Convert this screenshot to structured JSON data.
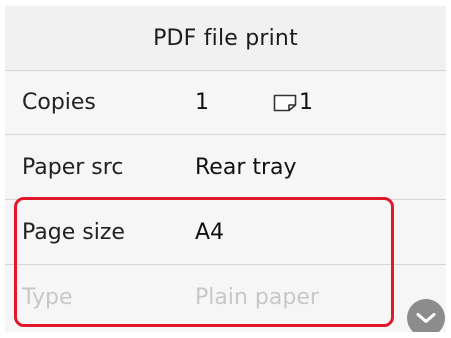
{
  "header": {
    "title": "PDF file print"
  },
  "settings": {
    "copies": {
      "label": "Copies",
      "value": "1",
      "sheets_icon": "sheet-icon",
      "sheets_value": "1"
    },
    "paper_source": {
      "label": "Paper src",
      "value": "Rear tray"
    },
    "page_size": {
      "label": "Page size",
      "value": "A4"
    },
    "type": {
      "label": "Type",
      "value": "Plain paper",
      "state": "disabled"
    }
  },
  "scroll_button": {
    "icon": "chevron-down-icon"
  },
  "colors": {
    "highlight": "#e0182c",
    "disabled_text": "#c8c8c8",
    "scroll_button": "#8c8c8c"
  }
}
